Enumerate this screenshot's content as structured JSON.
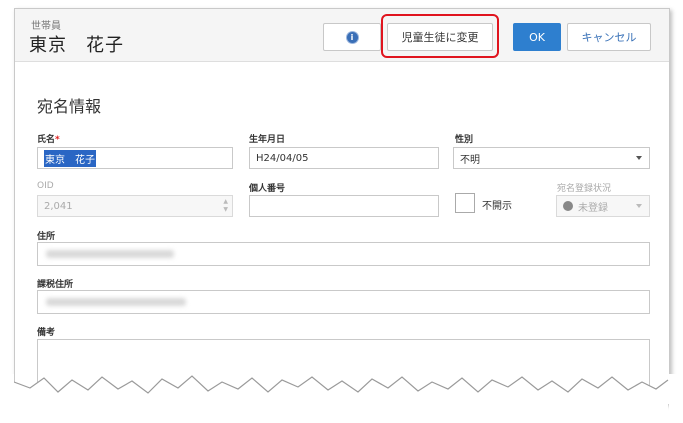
{
  "header": {
    "role_label": "世帯員",
    "member_name": "東京　花子",
    "info_icon": "info-circle-icon",
    "change_button": "児童生徒に変更",
    "ok_button": "OK",
    "cancel_button": "キャンセル"
  },
  "section": {
    "title": "宛名情報"
  },
  "form": {
    "name_label": "氏名",
    "required_mark": "*",
    "name_value": "東京　花子",
    "birth_label": "生年月日",
    "birth_value": "H24/04/05",
    "gender_label": "性別",
    "gender_value": "不明",
    "oid_label": "OID",
    "oid_value": "2,041",
    "personal_number_label": "個人番号",
    "personal_number_value": "",
    "nondisclosure_label": "不開示",
    "reg_status_label": "宛名登録状況",
    "reg_status_value": "未登録",
    "address_label": "住所",
    "tax_address_label": "課税住所",
    "remarks_label": "備考"
  },
  "colors": {
    "accent": "#2e7fcf",
    "highlight": "#e0141e",
    "required": "#e01e1e"
  }
}
